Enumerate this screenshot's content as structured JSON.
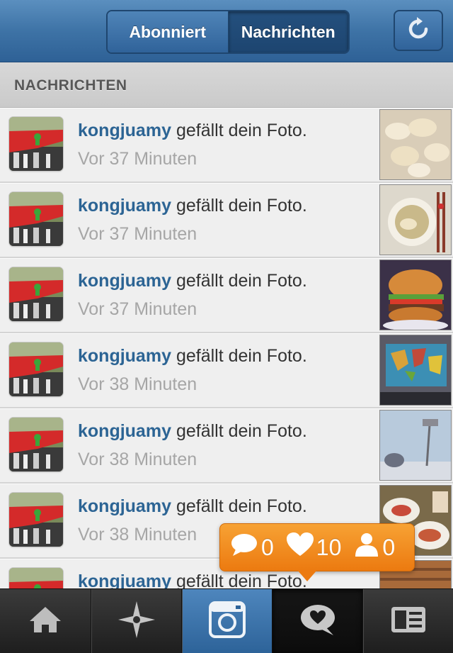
{
  "header": {
    "tab_following": "Abonniert",
    "tab_news": "Nachrichten"
  },
  "section": {
    "title": "NACHRICHTEN"
  },
  "rows": [
    {
      "user": "kongjuamy",
      "action": "gefällt dein Foto.",
      "time": "Vor 37 Minuten"
    },
    {
      "user": "kongjuamy",
      "action": "gefällt dein Foto.",
      "time": "Vor 37 Minuten"
    },
    {
      "user": "kongjuamy",
      "action": "gefällt dein Foto.",
      "time": "Vor 37 Minuten"
    },
    {
      "user": "kongjuamy",
      "action": "gefällt dein Foto.",
      "time": "Vor 38 Minuten"
    },
    {
      "user": "kongjuamy",
      "action": "gefällt dein Foto.",
      "time": "Vor 38 Minuten"
    },
    {
      "user": "kongjuamy",
      "action": "gefällt dein Foto.",
      "time": "Vor 38 Minuten"
    },
    {
      "user": "kongjuamy",
      "action": "gefällt dein Foto.",
      "time": ""
    }
  ],
  "notifications": {
    "comments": "0",
    "likes": "10",
    "followers": "0"
  },
  "tabbar": {
    "icons": [
      "home-icon",
      "explore-icon",
      "camera-icon",
      "news-icon",
      "profile-icon"
    ]
  },
  "colors": {
    "header": "#3e73a6",
    "username": "#2c6494",
    "bubble": "#f08a1e"
  }
}
